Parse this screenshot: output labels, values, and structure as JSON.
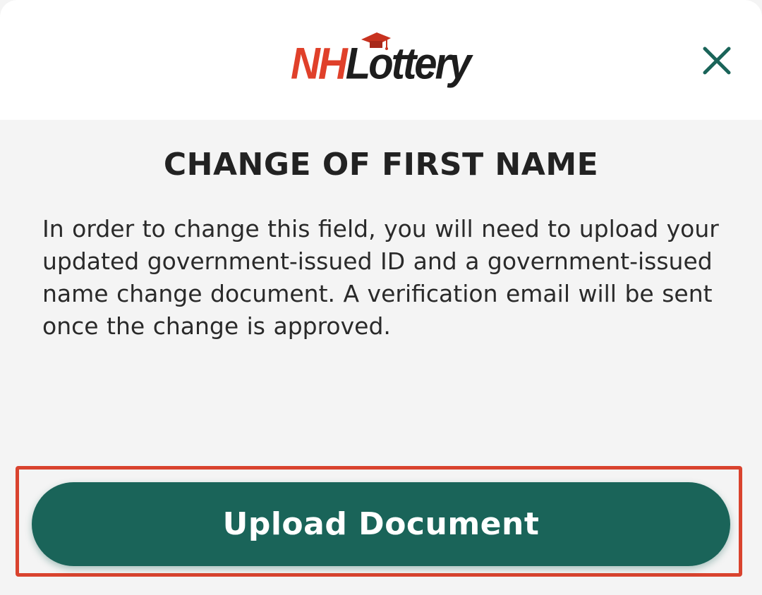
{
  "header": {
    "logo_nh": "NH",
    "logo_lottery": "Lottery",
    "close_icon": "close-icon",
    "accent_color": "#1a6459",
    "logo_red": "#e0402a"
  },
  "dialog": {
    "title": "CHANGE OF FIRST NAME",
    "message": "In order to change this field, you will need to upload your updated government-issued ID and a government-issued name change document. A verification email will be sent once the change is approved."
  },
  "actions": {
    "upload_label": "Upload Document",
    "highlight_color": "#d9432e"
  }
}
